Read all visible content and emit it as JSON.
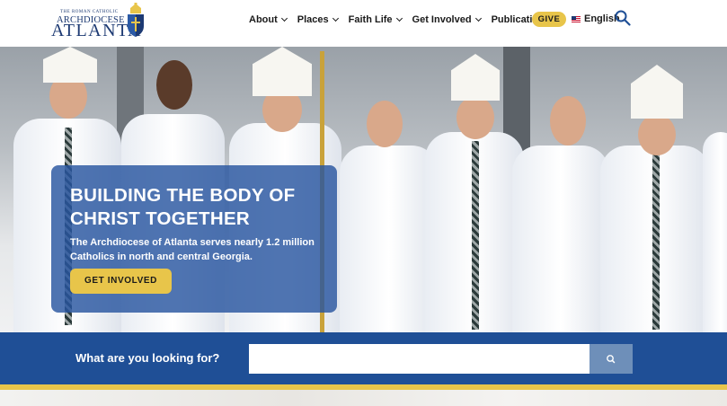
{
  "logo": {
    "small_text": "THE ROMAN CATHOLIC",
    "archdiocese": "ARCHDIOCESE OF",
    "city": "ATLANTA"
  },
  "nav": {
    "items": [
      {
        "label": "About"
      },
      {
        "label": "Places"
      },
      {
        "label": "Faith Life"
      },
      {
        "label": "Get Involved"
      },
      {
        "label": "Publications"
      }
    ],
    "give_label": "GIVE",
    "language_label": "English"
  },
  "hero": {
    "title": "BUILDING THE BODY OF CHRIST TOGETHER",
    "subtitle": "The Archdiocese of Atlanta serves nearly 1.2 million Catholics in north and central Georgia.",
    "button_label": "GET INVOLVED"
  },
  "search": {
    "label": "What are you looking for?",
    "placeholder": ""
  },
  "colors": {
    "brand_navy": "#1d3a73",
    "accent_gold": "#e8c54a",
    "search_bar_blue": "#1f4f96",
    "overlay_blue": "#2856a0"
  }
}
